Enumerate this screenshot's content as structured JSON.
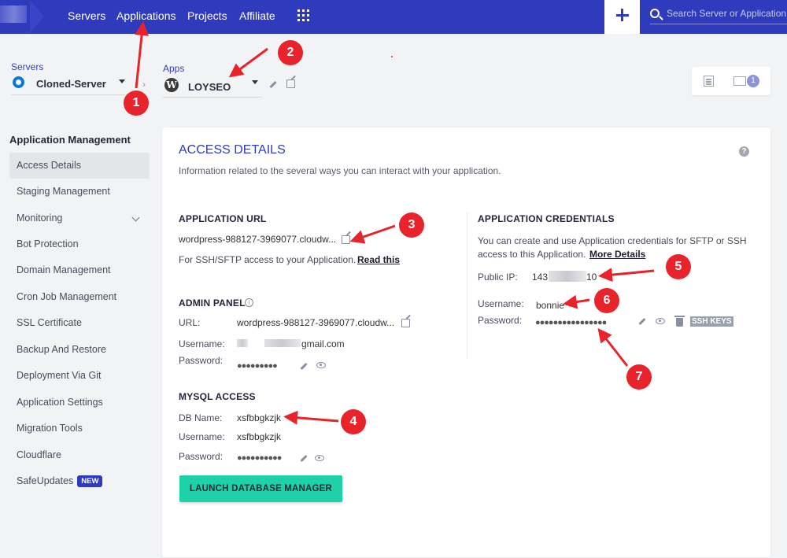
{
  "nav": {
    "items": [
      "Servers",
      "Applications",
      "Projects",
      "Affiliate"
    ],
    "search_placeholder": "Search Server or Application"
  },
  "server_selector": {
    "label": "Servers",
    "value": "Cloned-Server"
  },
  "app_selector": {
    "label": "Apps",
    "value": "LOYSEO"
  },
  "toolbar": {
    "notification_count": "1"
  },
  "sidebar": {
    "title": "Application Management",
    "items": [
      "Access Details",
      "Staging Management",
      "Monitoring",
      "Bot Protection",
      "Domain Management",
      "Cron Job Management",
      "SSL Certificate",
      "Backup And Restore",
      "Deployment Via Git",
      "Application Settings",
      "Migration Tools",
      "Cloudflare",
      "SafeUpdates"
    ],
    "new_badge": "NEW"
  },
  "access": {
    "title": "ACCESS DETAILS",
    "description": "Information related to the several ways you can interact with your application."
  },
  "app_url": {
    "title": "APPLICATION URL",
    "url": "wordpress-988127-3969077.cloudw...",
    "ssh_note": "For SSH/SFTP access to your Application.",
    "read_this": "Read this"
  },
  "admin_panel": {
    "title": "ADMIN PANEL",
    "url_label": "URL:",
    "url_value": "wordpress-988127-3969077.cloudw...",
    "username_label": "Username:",
    "username_value": "gmail.com",
    "password_label": "Password:",
    "password_dots": "●●●●●●●●●"
  },
  "mysql": {
    "title": "MYSQL ACCESS",
    "db_name_label": "DB Name:",
    "db_name_value": "xsfbbgkzjk",
    "username_label": "Username:",
    "username_value": "xsfbbgkzjk",
    "password_label": "Password:",
    "password_dots": "●●●●●●●●●●"
  },
  "credentials": {
    "title": "APPLICATION CREDENTIALS",
    "description_line1": "You can create and use Application credentials for SFTP or SSH",
    "description_line2": "access to this Application.",
    "more_details": "More Details",
    "public_ip_label": "Public IP:",
    "public_ip_prefix": "143",
    "public_ip_suffix": "10",
    "username_label": "Username:",
    "username_value": "bonnie",
    "password_label": "Password:",
    "password_dots": "●●●●●●●●●●●●●●●●",
    "ssh_keys": "SSH KEYS"
  },
  "launch_button": "LAUNCH DATABASE MANAGER",
  "annotations": [
    "1",
    "2",
    "3",
    "4",
    "5",
    "6",
    "7"
  ],
  "colors": {
    "nav_bg": "#2f3bbd",
    "accent": "#2f3bbd",
    "button": "#1ed1a7",
    "annotation": "#e8232b"
  }
}
